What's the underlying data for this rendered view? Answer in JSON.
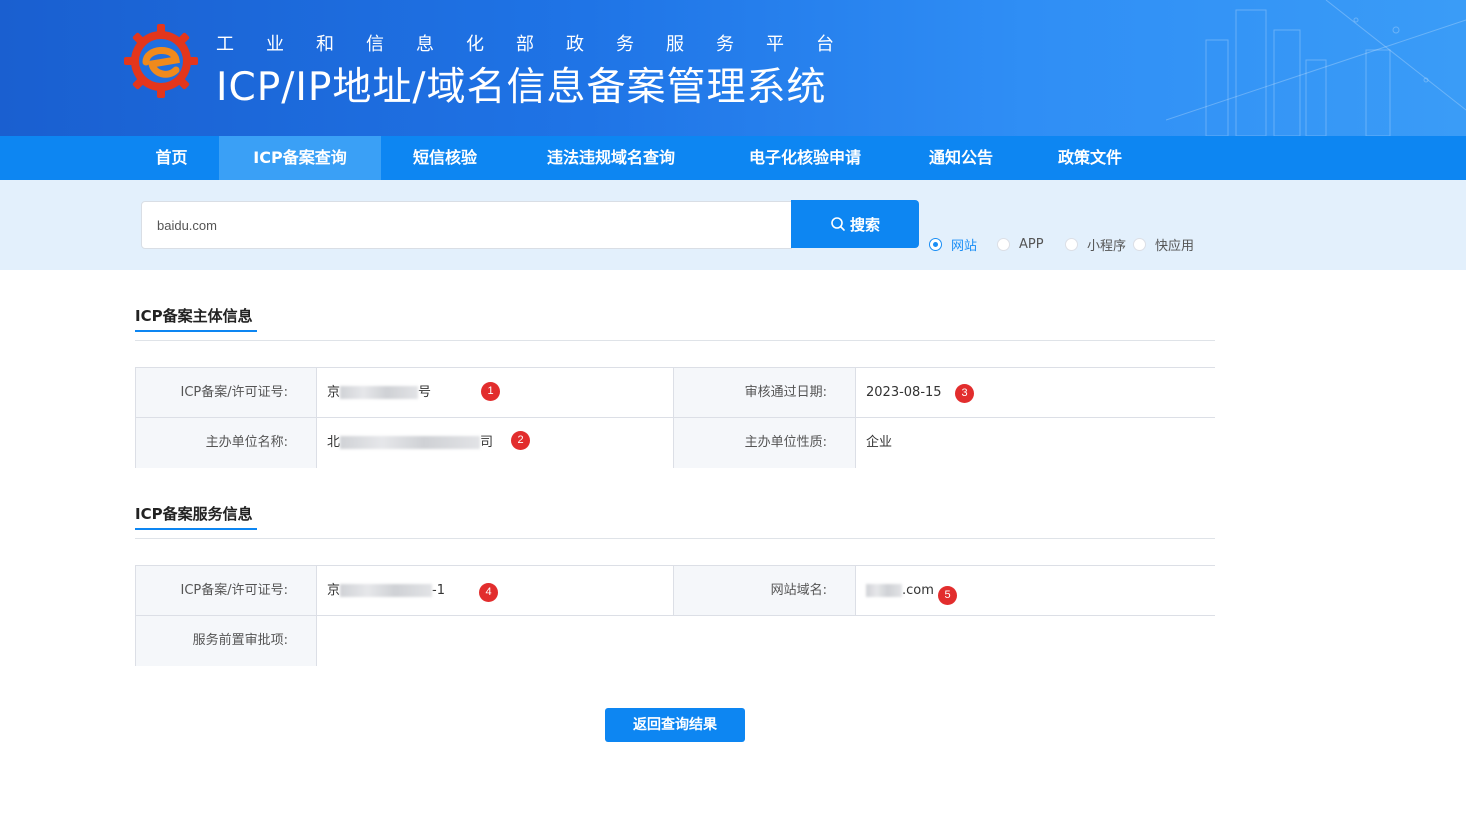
{
  "header": {
    "subtitle_chars": [
      "工",
      "业",
      "和",
      "信",
      "息",
      "化",
      "部",
      "政",
      "务",
      "服",
      "务",
      "平",
      "台"
    ],
    "title": "ICP/IP地址/域名信息备案管理系统",
    "logo_icon": "gear-e-logo-icon"
  },
  "nav": {
    "items": [
      {
        "label": "首页"
      },
      {
        "label": "ICP备案查询"
      },
      {
        "label": "短信核验"
      },
      {
        "label": "违法违规域名查询"
      },
      {
        "label": "电子化核验申请"
      },
      {
        "label": "通知公告"
      },
      {
        "label": "政策文件"
      }
    ],
    "active": "ICP备案查询"
  },
  "search": {
    "value": "baidu.com",
    "button_label": "搜索",
    "button_icon": "search-icon",
    "types": [
      {
        "label": "网站",
        "checked": true
      },
      {
        "label": "APP",
        "checked": false
      },
      {
        "label": "小程序",
        "checked": false
      },
      {
        "label": "快应用",
        "checked": false
      }
    ]
  },
  "entity": {
    "title": "ICP备案主体信息",
    "license_label": "ICP备案/许可证号:",
    "license_prefix": "京",
    "license_suffix": "号",
    "approve_date_label": "审核通过日期:",
    "approve_date": "2023-08-15",
    "org_name_label": "主办单位名称:",
    "org_name_prefix": "北",
    "org_name_suffix": "司",
    "org_type_label": "主办单位性质:",
    "org_type": "企业"
  },
  "service": {
    "title": "ICP备案服务信息",
    "license_label": "ICP备案/许可证号:",
    "license_prefix": "京",
    "license_suffix": "-1",
    "domain_label": "网站域名:",
    "domain_suffix": ".com",
    "preapproval_label": "服务前置审批项:",
    "preapproval_value": ""
  },
  "badges": [
    "1",
    "2",
    "3",
    "4",
    "5"
  ],
  "back_button_label": "返回查询结果",
  "colors": {
    "primary": "#0d86f2",
    "nav_active": "#3aa0f6",
    "badge": "#e22d2d",
    "search_band": "#e3f0fc"
  }
}
